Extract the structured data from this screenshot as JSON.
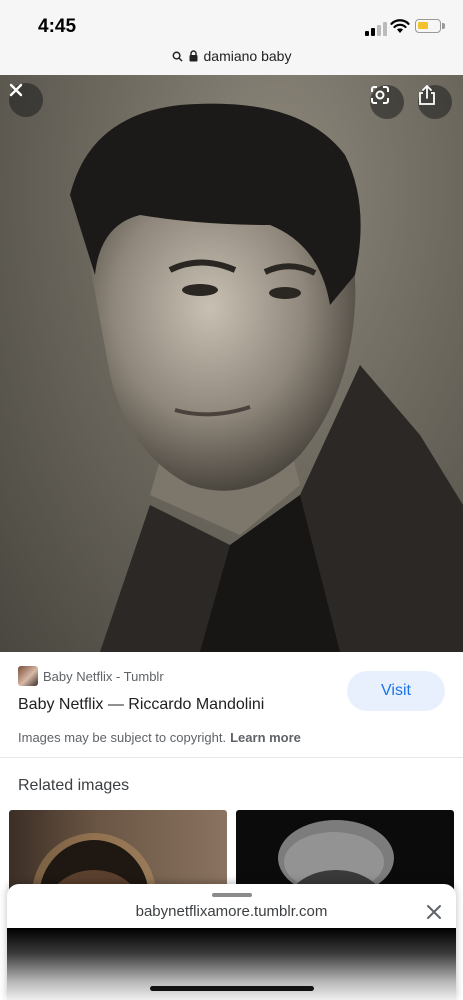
{
  "status_bar": {
    "time": "4:45"
  },
  "url_bar": {
    "text": "damiano baby"
  },
  "photo": {
    "lens_icon": "lens-icon",
    "share_icon": "share-icon",
    "close_icon": "close-icon"
  },
  "result": {
    "source_name": "Baby Netflix - Tumblr",
    "title": "Baby Netflix — Riccardo Mandolini",
    "visit_label": "Visit",
    "copyright_text": "Images may be subject to copyright.",
    "learn_more": "Learn more"
  },
  "related": {
    "title": "Related images"
  },
  "sheet": {
    "url": "babynetflixamore.tumblr.com"
  },
  "colors": {
    "accent": "#1a73e8",
    "visit_bg": "#e8f0fe",
    "battery": "#f2c12e"
  }
}
